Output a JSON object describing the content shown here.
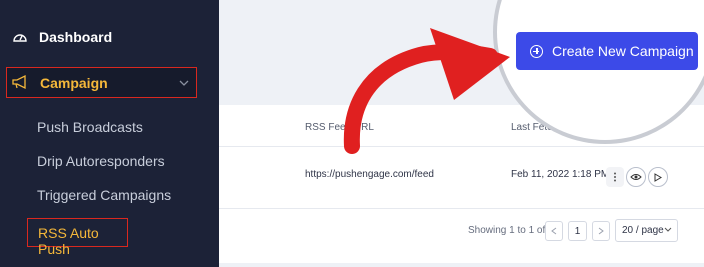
{
  "sidebar": {
    "dashboard_label": "Dashboard",
    "campaign_label": "Campaign",
    "items": [
      {
        "label": "Push Broadcasts"
      },
      {
        "label": "Drip Autoresponders"
      },
      {
        "label": "Triggered Campaigns"
      },
      {
        "label": "RSS Auto Push"
      }
    ]
  },
  "header": {
    "create_button_label": "Create New Campaign"
  },
  "table": {
    "columns": [
      "RSS Feed URL",
      "Last Fetch Time"
    ],
    "rows": [
      {
        "url": "https://pushengage.com/feed",
        "last_fetch": "Feb 11, 2022 1:18 PM"
      }
    ]
  },
  "pagination": {
    "summary": "Showing 1 to 1 of 1",
    "current_page": "1",
    "page_size": "20 / page"
  },
  "colors": {
    "sidebar_bg": "#1c2237",
    "accent_orange": "#f5b83a",
    "highlight_red": "#d9281f",
    "primary_blue": "#3c4ae8",
    "arrow_red": "#e02020"
  }
}
